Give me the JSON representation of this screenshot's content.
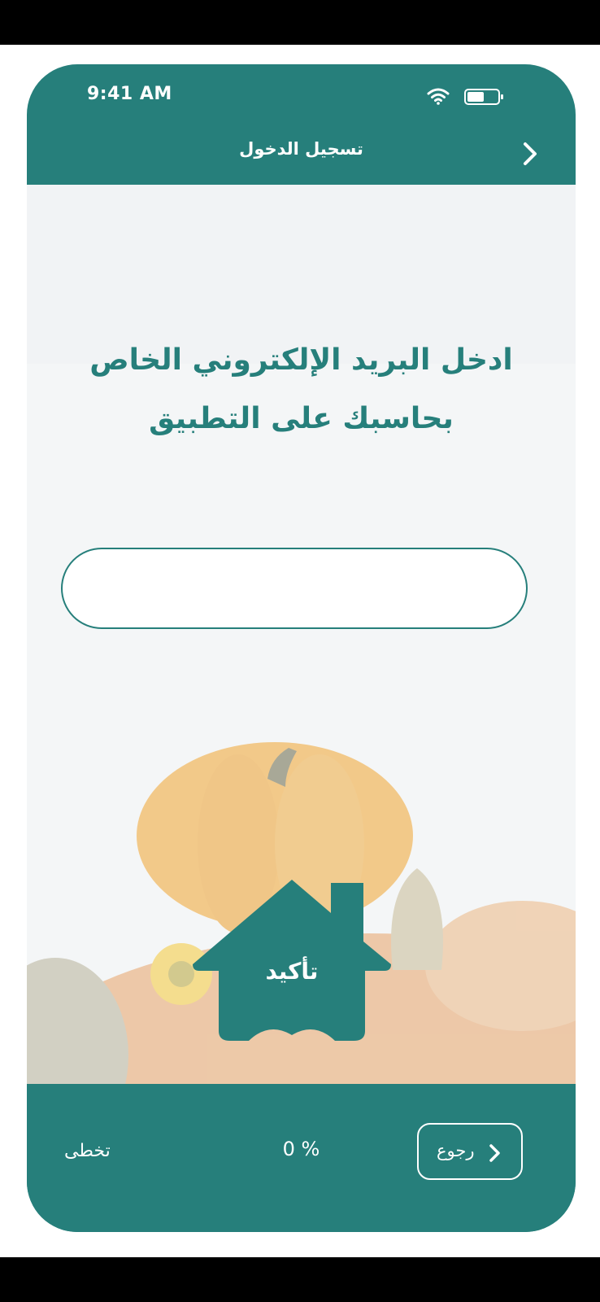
{
  "status_bar": {
    "time": "9:41 AM"
  },
  "nav": {
    "title": "تسجيل الدخول",
    "back_icon": "chevron-right-icon"
  },
  "main": {
    "heading_line1": "ادخل البريد الإلكتروني الخاص",
    "heading_line2": "بحاسبك على التطبيق",
    "email_value": "",
    "confirm_label": "تأكيد"
  },
  "footer": {
    "skip_label": "تخطى",
    "progress_label": "0 %",
    "back_label": "رجوع",
    "back_icon": "chevron-right-icon"
  },
  "colors": {
    "primary": "#267f7b",
    "background": "#f1f3f5",
    "text_on_primary": "#ffffff"
  }
}
